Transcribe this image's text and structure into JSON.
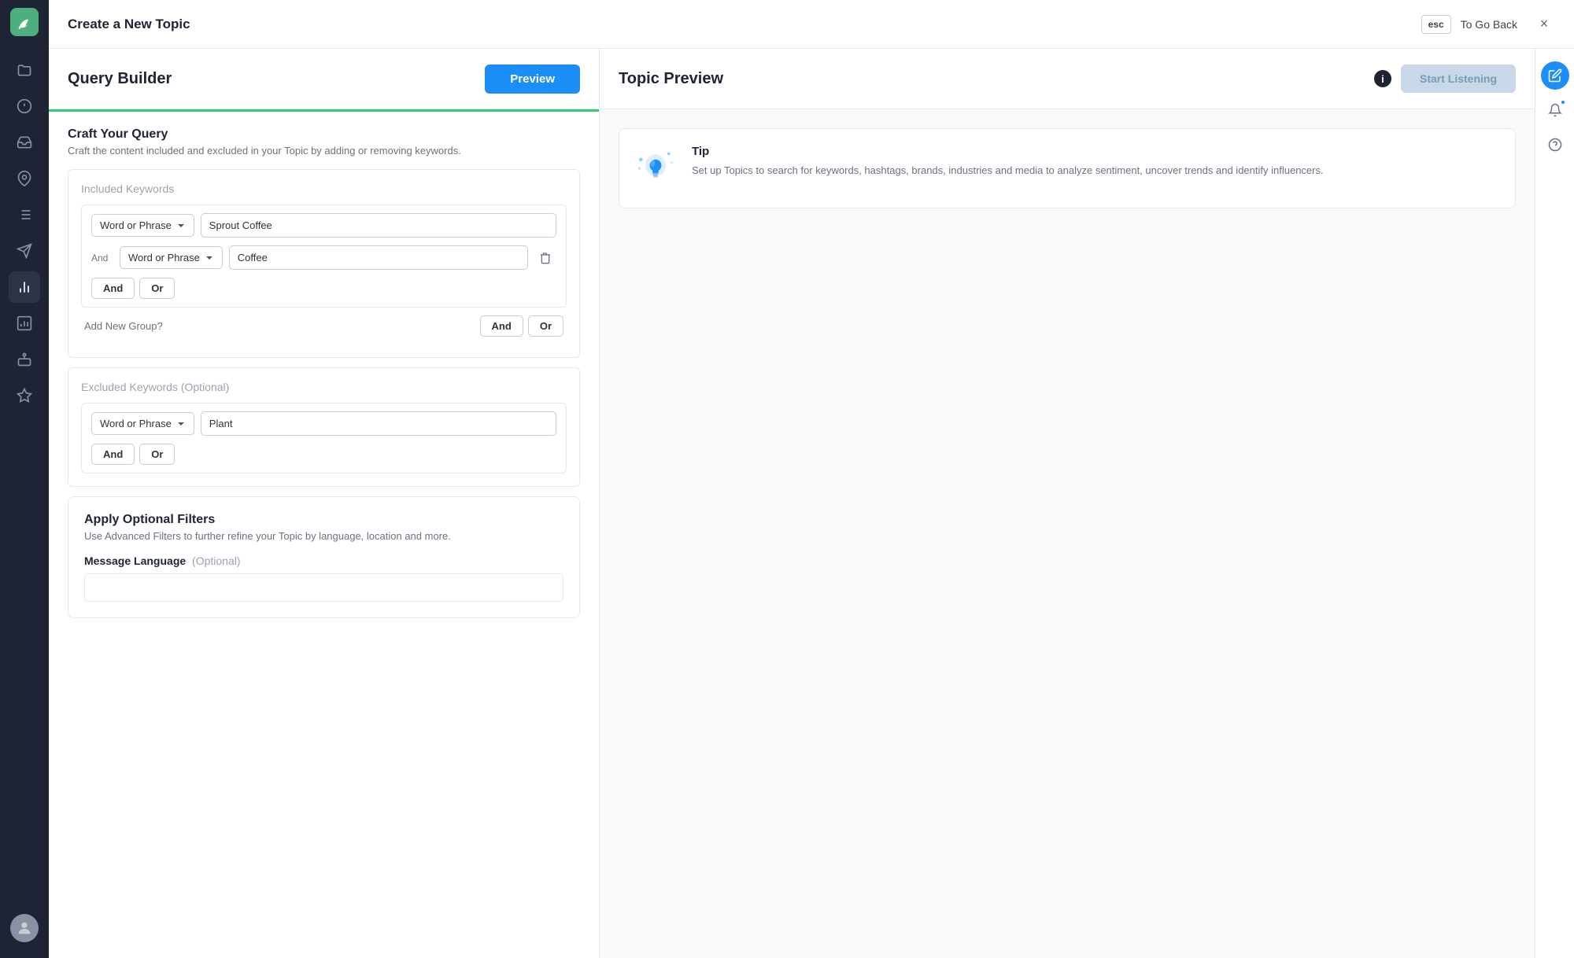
{
  "topbar": {
    "title": "Create a New Topic",
    "esc_label": "esc",
    "to_go_back": "To Go Back",
    "close_label": "×"
  },
  "query_builder": {
    "panel_title": "Query Builder",
    "preview_btn": "Preview",
    "craft_section": {
      "title": "Craft Your Query",
      "description": "Craft the content included and excluded in your Topic by adding or removing keywords."
    },
    "included_keywords": {
      "title": "Included Keywords",
      "group1": {
        "type_label": "Word or Phrase",
        "value": "Sprout Coffee"
      },
      "group1_sub": {
        "connector": "And",
        "type_label": "Word or Phrase",
        "value": "Coffee"
      },
      "and_label": "And",
      "or_label": "Or"
    },
    "add_new_group": {
      "label": "Add New Group?",
      "and_label": "And",
      "or_label": "Or"
    },
    "excluded_keywords": {
      "title": "Excluded Keywords",
      "optional_label": "(Optional)",
      "group1": {
        "type_label": "Word or Phrase",
        "value": "Plant"
      },
      "and_label": "And",
      "or_label": "Or"
    },
    "optional_filters": {
      "title": "Apply Optional Filters",
      "description": "Use Advanced Filters to further refine your Topic by language, location and more."
    },
    "message_language": {
      "label": "Message Language",
      "optional_label": "(Optional)"
    }
  },
  "topic_preview": {
    "panel_title": "Topic Preview",
    "info_label": "i",
    "start_listening_btn": "Start Listening",
    "tip": {
      "title": "Tip",
      "text": "Set up Topics to search for keywords, hashtags, brands, industries and media to analyze sentiment, uncover trends and identify influencers."
    }
  },
  "sidebar": {
    "items": [
      {
        "name": "folder-icon",
        "symbol": "▣"
      },
      {
        "name": "alert-icon",
        "symbol": "⚠"
      },
      {
        "name": "inbox-icon",
        "symbol": "✉"
      },
      {
        "name": "pin-icon",
        "symbol": "📌"
      },
      {
        "name": "list-icon",
        "symbol": "☰"
      },
      {
        "name": "send-icon",
        "symbol": "➤"
      },
      {
        "name": "chart-icon",
        "symbol": "📊",
        "active": true
      },
      {
        "name": "bar-chart-icon",
        "symbol": "📈"
      },
      {
        "name": "bot-icon",
        "symbol": "🤖"
      },
      {
        "name": "star-icon",
        "symbol": "★"
      }
    ]
  }
}
